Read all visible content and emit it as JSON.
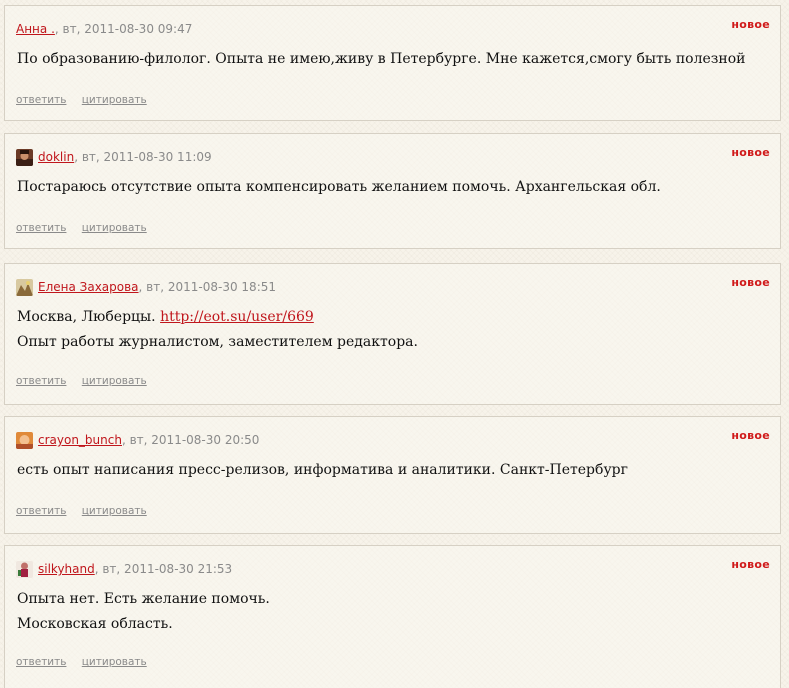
{
  "comments": [
    {
      "author": "Анна .",
      "meta": ", вт, 2011-08-30 09:47",
      "badge": "новое",
      "lines": [
        "По образованию-филолог. Опыта не имею,живу в Петербурге. Мне кажется,смогу быть полезной"
      ],
      "reply": "ответить",
      "quote": "цитировать",
      "has_avatar": false
    },
    {
      "author": "doklin",
      "meta": ", вт, 2011-08-30 11:09",
      "badge": "новое",
      "lines": [
        "Постараюсь отсутствие опыта компенсировать желанием помочь. Архангельская обл."
      ],
      "reply": "ответить",
      "quote": "цитировать",
      "has_avatar": true
    },
    {
      "author": "Елена Захарова",
      "meta": ", вт, 2011-08-30 18:51",
      "badge": "новое",
      "line1_prefix": "Москва, Люберцы. ",
      "link": "http://eot.su/user/669",
      "lines": [
        "Опыт работы журналистом, заместителем редактора."
      ],
      "reply": "ответить",
      "quote": "цитировать",
      "has_avatar": true
    },
    {
      "author": "crayon_bunch",
      "meta": ", вт, 2011-08-30 20:50",
      "badge": "новое",
      "lines": [
        "есть опыт написания пресс-релизов, информатива и аналитики. Санкт-Петербург"
      ],
      "reply": "ответить",
      "quote": "цитировать",
      "has_avatar": true
    },
    {
      "author": "silkyhand",
      "meta": ", вт, 2011-08-30 21:53",
      "badge": "новое",
      "lines": [
        "Опыта нет. Есть желание помочь.",
        "Московская область."
      ],
      "reply": "ответить",
      "quote": "цитировать",
      "has_avatar": true
    }
  ]
}
